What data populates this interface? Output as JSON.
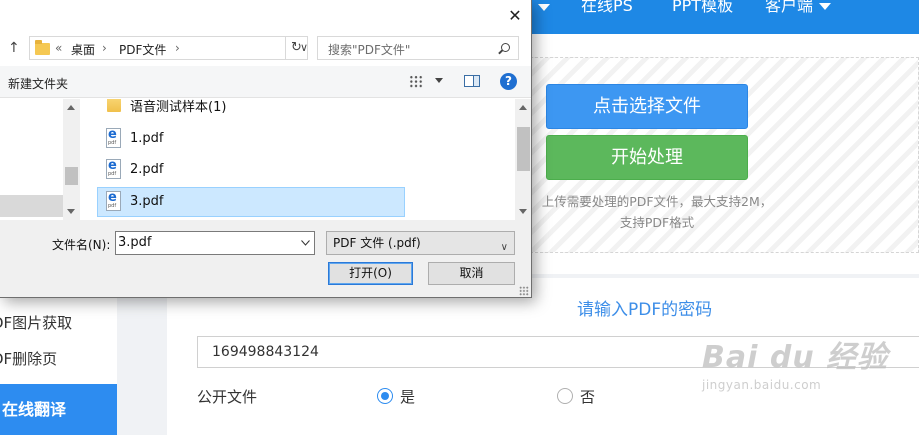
{
  "nav": {
    "items": [
      {
        "label": "在线PS"
      },
      {
        "label": "PPT模板"
      },
      {
        "label": "客户端"
      }
    ]
  },
  "sidebar": {
    "items": [
      {
        "label": "DF图片获取"
      },
      {
        "label": "DF删除页"
      },
      {
        "label": "在线翻译"
      }
    ]
  },
  "upload": {
    "select_button": "点击选择文件",
    "start_button": "开始处理",
    "hint_line1": "上传需要处理的PDF文件，最大支持2M，",
    "hint_line2": "支持PDF格式"
  },
  "password": {
    "title": "请输入PDF的密码",
    "value": "169498843124"
  },
  "public_file": {
    "label": "公开文件",
    "options": [
      {
        "label": "是",
        "checked": true
      },
      {
        "label": "否",
        "checked": false
      }
    ]
  },
  "watermark": {
    "main": "Bai du 经验",
    "sub": "jingyan.baidu.com"
  },
  "dialog": {
    "close": "✕",
    "address": {
      "chevrons": "«",
      "segment1": "桌面",
      "separator1": "›",
      "segment2": "PDF文件",
      "separator2": "›",
      "dropdown": "∨"
    },
    "refresh": "↻",
    "search_placeholder": "搜索\"PDF文件\"",
    "new_folder": "新建文件夹",
    "help": "?",
    "files": [
      {
        "name": "语音测试样本(1)",
        "type": "folder",
        "selected": false
      },
      {
        "name": "1.pdf",
        "type": "pdf",
        "selected": false
      },
      {
        "name": "2.pdf",
        "type": "pdf",
        "selected": false
      },
      {
        "name": "3.pdf",
        "type": "pdf",
        "selected": true
      }
    ],
    "pdf_icon_letter": "e",
    "pdf_icon_text": "pdf",
    "filename_label": "文件名(N):",
    "filename_value": "3.pdf",
    "filetype_value": "PDF 文件 (.pdf)",
    "filetype_dropdown": "∨",
    "open_button": "打开(O)",
    "cancel_button": "取消"
  },
  "colors": {
    "nav_bg": "#1e88e5",
    "select_btn": "#3d97f2",
    "start_btn": "#5cb85c",
    "accent": "#2d8cf0",
    "selection": "#cce8ff"
  }
}
